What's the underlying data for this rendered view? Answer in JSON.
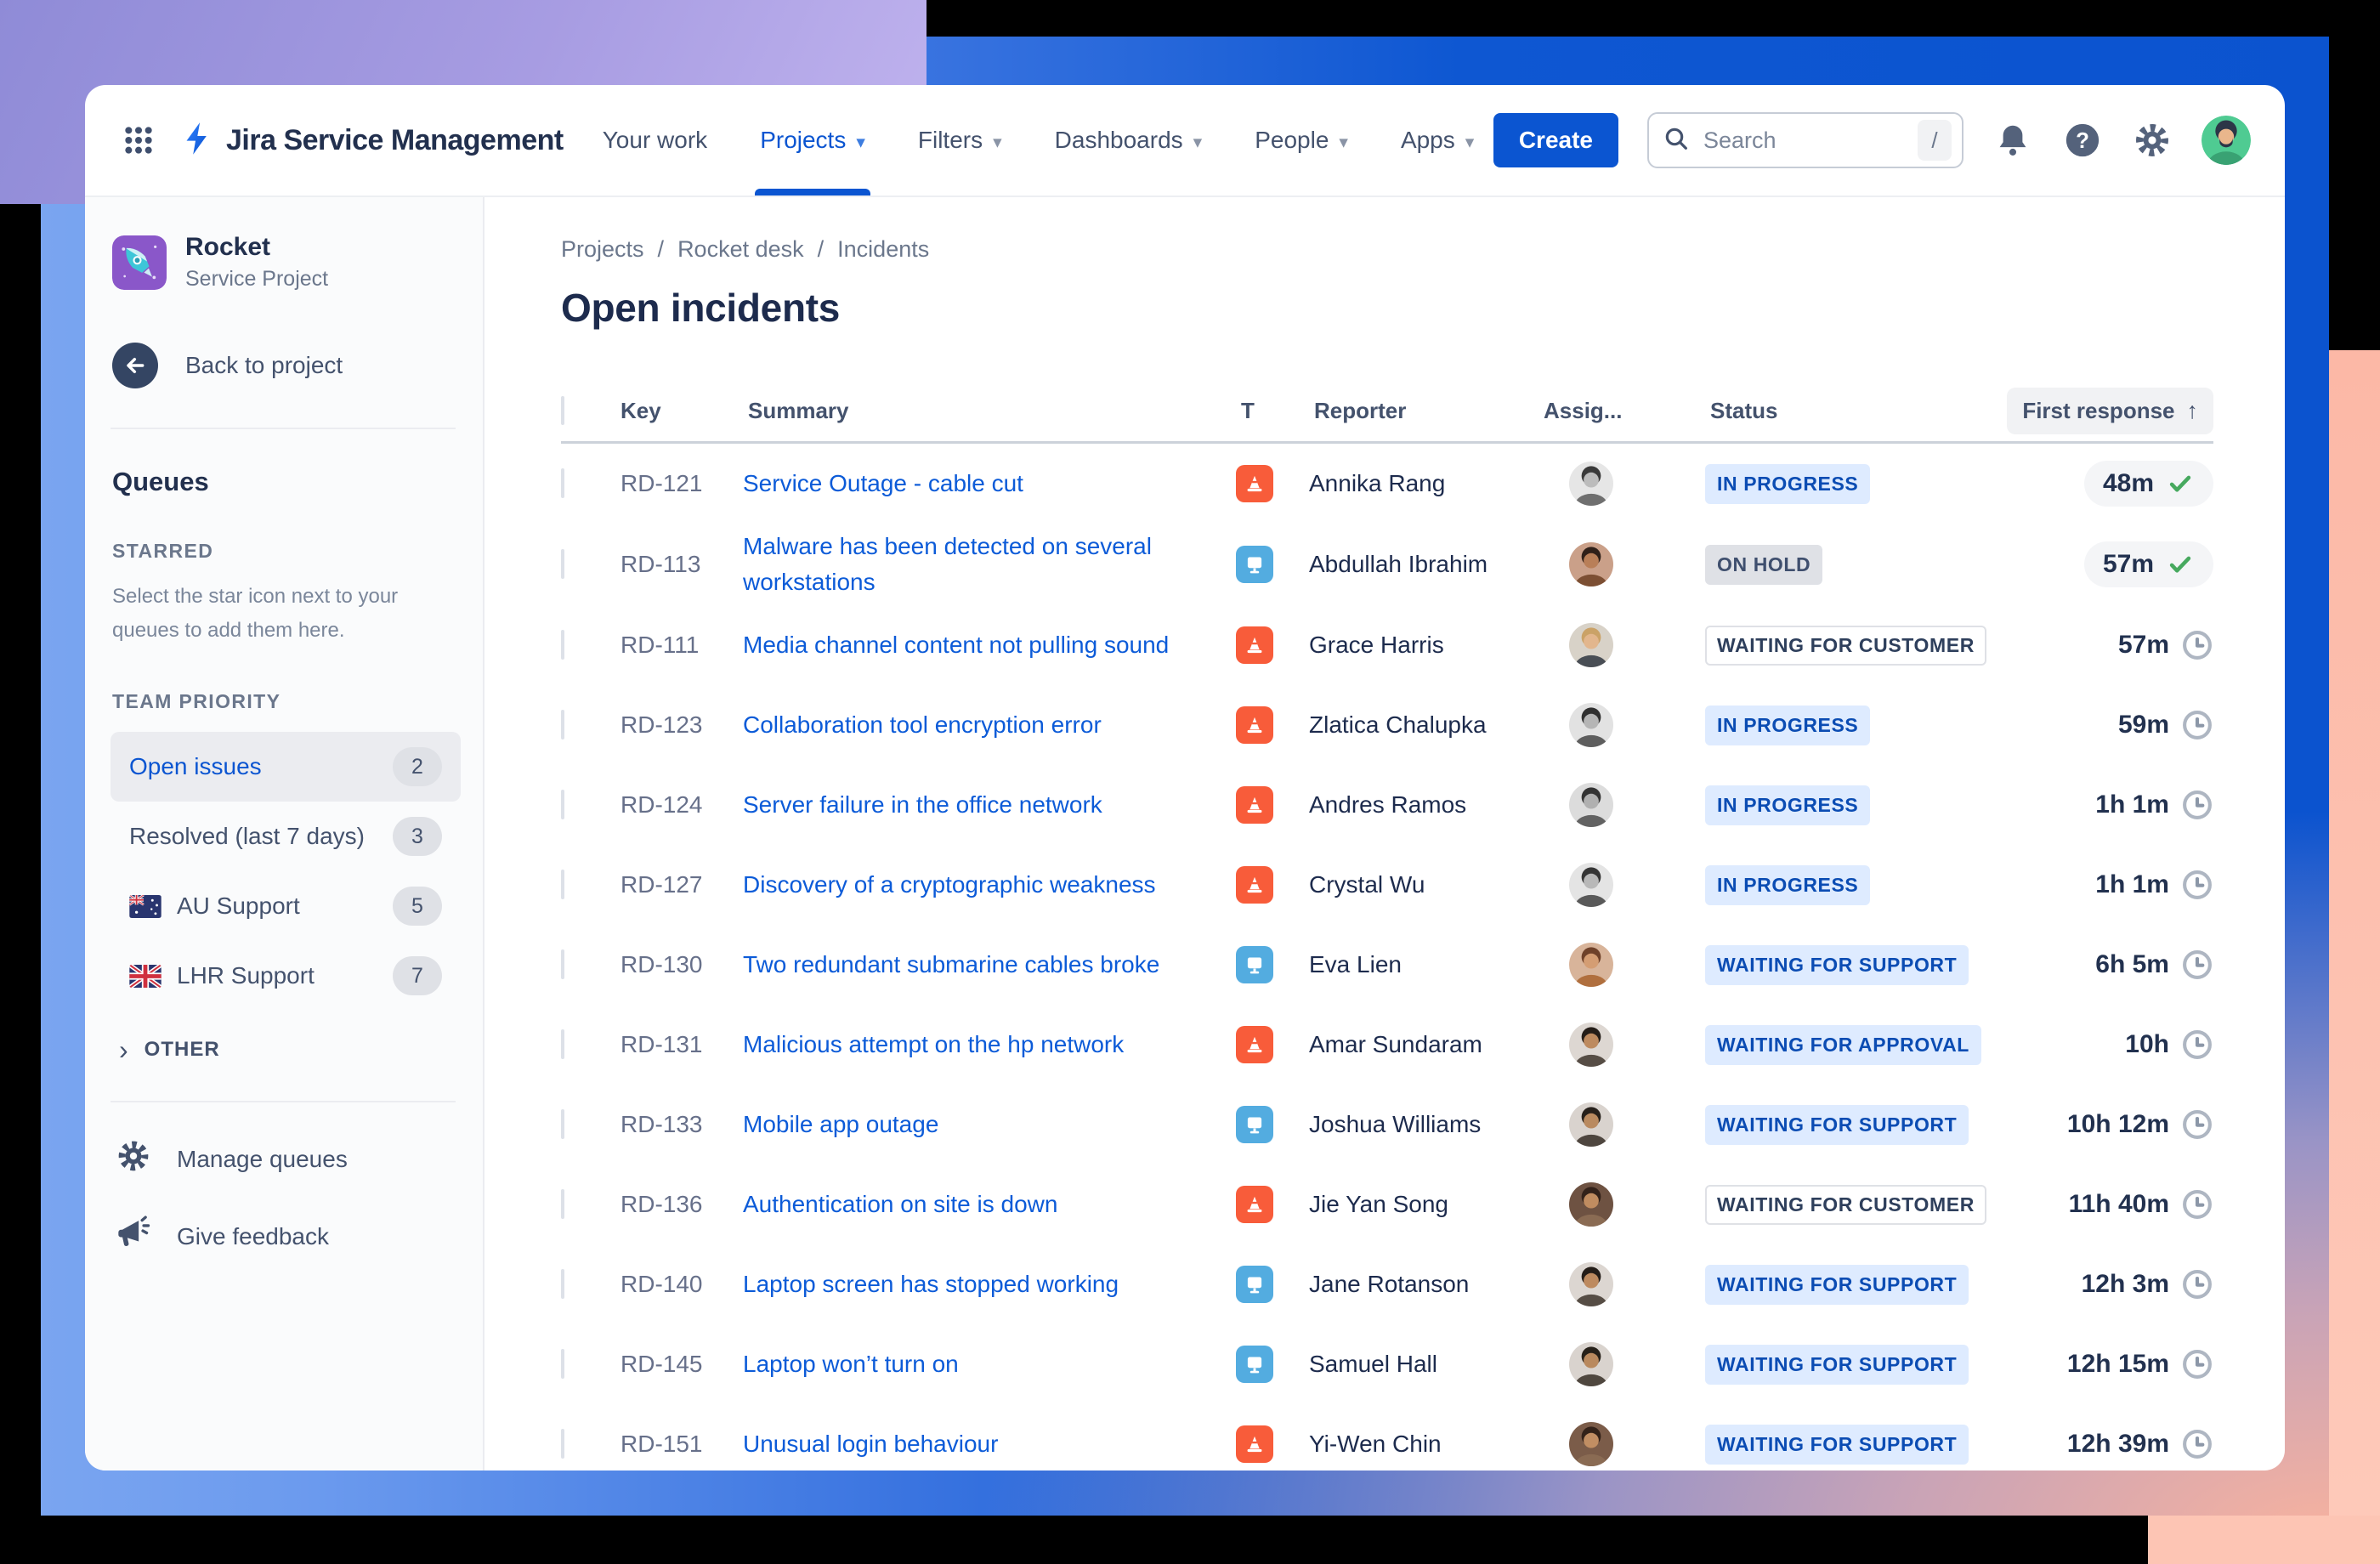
{
  "topbar": {
    "logo_text": "Jira Service Management",
    "nav": [
      {
        "label": "Your work",
        "caret": false,
        "active": false
      },
      {
        "label": "Projects",
        "caret": true,
        "active": true
      },
      {
        "label": "Filters",
        "caret": true,
        "active": false
      },
      {
        "label": "Dashboards",
        "caret": true,
        "active": false
      },
      {
        "label": "People",
        "caret": true,
        "active": false
      },
      {
        "label": "Apps",
        "caret": true,
        "active": false
      }
    ],
    "create_label": "Create",
    "search_placeholder": "Search",
    "search_shortcut": "/",
    "icons": [
      "app-switcher-icon",
      "bell-icon",
      "help-icon",
      "gear-icon",
      "user-avatar"
    ]
  },
  "sidebar": {
    "project_name": "Rocket",
    "project_type": "Service Project",
    "back_label": "Back to project",
    "queues_title": "Queues",
    "starred_label": "STARRED",
    "starred_hint": "Select the star icon next to your queues to add them here.",
    "team_priority_label": "TEAM PRIORITY",
    "queues": [
      {
        "label": "Open issues",
        "count": "2",
        "flag": null,
        "selected": true
      },
      {
        "label": "Resolved (last 7 days)",
        "count": "3",
        "flag": null,
        "selected": false
      },
      {
        "label": "AU Support",
        "count": "5",
        "flag": "au",
        "selected": false
      },
      {
        "label": "LHR Support",
        "count": "7",
        "flag": "gb",
        "selected": false
      }
    ],
    "other_label": "OTHER",
    "manage_label": "Manage queues",
    "feedback_label": "Give feedback"
  },
  "main": {
    "breadcrumb": [
      "Projects",
      "Rocket desk",
      "Incidents"
    ],
    "title": "Open incidents",
    "columns": {
      "key": "Key",
      "summary": "Summary",
      "type": "T",
      "reporter": "Reporter",
      "assignee": "Assig...",
      "status": "Status",
      "first_response": "First response",
      "sort_arrow": "↑"
    },
    "rows": [
      {
        "key": "RD-121",
        "summary": "Service Outage - cable cut",
        "type": "incident",
        "reporter": "Annika Rang",
        "status": {
          "label": "IN PROGRESS",
          "style": "blue"
        },
        "first_response": "48m",
        "met": true,
        "avatar": {
          "bg": "#e6e6e6",
          "skin": "#bcbcbc",
          "hair": "#3a3a3a",
          "shirt": "#6f6f6f"
        }
      },
      {
        "key": "RD-113",
        "summary": "Malware has been detected on several workstations",
        "type": "request",
        "reporter": "Abdullah Ibrahim",
        "status": {
          "label": "ON HOLD",
          "style": "gray"
        },
        "first_response": "57m",
        "met": true,
        "avatar": {
          "bg": "#caa089",
          "skin": "#b97f58",
          "hair": "#2f2019",
          "shirt": "#7c4f33"
        }
      },
      {
        "key": "RD-111",
        "summary": "Media channel content not pulling sound",
        "type": "incident",
        "reporter": "Grace Harris",
        "status": {
          "label": "WAITING FOR CUSTOMER",
          "style": "outline"
        },
        "first_response": "57m",
        "met": false,
        "avatar": {
          "bg": "#d8d2c8",
          "skin": "#e2b68d",
          "hair": "#caa267",
          "shirt": "#494e55"
        }
      },
      {
        "key": "RD-123",
        "summary": "Collaboration tool encryption error",
        "type": "incident",
        "reporter": "Zlatica Chalupka",
        "status": {
          "label": "IN PROGRESS",
          "style": "blue"
        },
        "first_response": "59m",
        "met": false,
        "avatar": {
          "bg": "#e2e2e2",
          "skin": "#b5b5b5",
          "hair": "#2f2f2f",
          "shirt": "#5e5e5e"
        }
      },
      {
        "key": "RD-124",
        "summary": "Server failure in the office network",
        "type": "incident",
        "reporter": "Andres Ramos",
        "status": {
          "label": "IN PROGRESS",
          "style": "blue"
        },
        "first_response": "1h 1m",
        "met": false,
        "avatar": {
          "bg": "#dcdcdc",
          "skin": "#b0b0b0",
          "hair": "#333333",
          "shirt": "#626262"
        }
      },
      {
        "key": "RD-127",
        "summary": "Discovery of a cryptographic weakness",
        "type": "incident",
        "reporter": "Crystal Wu",
        "status": {
          "label": "IN PROGRESS",
          "style": "blue"
        },
        "first_response": "1h 1m",
        "met": false,
        "avatar": {
          "bg": "#e4e4e4",
          "skin": "#b8b8b8",
          "hair": "#353535",
          "shirt": "#595959"
        }
      },
      {
        "key": "RD-130",
        "summary": "Two redundant submarine cables broke",
        "type": "request",
        "reporter": "Eva Lien",
        "status": {
          "label": "WAITING FOR SUPPORT",
          "style": "blue"
        },
        "first_response": "6h 5m",
        "met": false,
        "avatar": {
          "bg": "#d8b49a",
          "skin": "#d49d73",
          "hair": "#6e4129",
          "shirt": "#b06f3e"
        }
      },
      {
        "key": "RD-131",
        "summary": "Malicious attempt on the hp network",
        "type": "incident",
        "reporter": "Amar Sundaram",
        "status": {
          "label": "WAITING FOR APPROVAL",
          "style": "blue"
        },
        "first_response": "10h",
        "met": false,
        "avatar": {
          "bg": "#ddd7d2",
          "skin": "#bd8a5f",
          "hair": "#241d18",
          "shirt": "#564d45"
        }
      },
      {
        "key": "RD-133",
        "summary": "Mobile app outage",
        "type": "request",
        "reporter": "Joshua Williams",
        "status": {
          "label": "WAITING FOR SUPPORT",
          "style": "blue"
        },
        "first_response": "10h 12m",
        "met": false,
        "avatar": {
          "bg": "#d9d3ce",
          "skin": "#b98a60",
          "hair": "#26201b",
          "shirt": "#4e463f"
        }
      },
      {
        "key": "RD-136",
        "summary": "Authentication on site is down",
        "type": "incident",
        "reporter": "Jie Yan Song",
        "status": {
          "label": "WAITING FOR CUSTOMER",
          "style": "outline"
        },
        "first_response": "11h 40m",
        "met": false,
        "avatar": {
          "bg": "#6e5242",
          "skin": "#c08c60",
          "hair": "#33221a",
          "shirt": "#8a6b53"
        }
      },
      {
        "key": "RD-140",
        "summary": "Laptop screen has stopped working",
        "type": "request",
        "reporter": "Jane Rotanson",
        "status": {
          "label": "WAITING FOR SUPPORT",
          "style": "blue"
        },
        "first_response": "12h 3m",
        "met": false,
        "avatar": {
          "bg": "#dcd6d1",
          "skin": "#bd8a5f",
          "hair": "#241d18",
          "shirt": "#564d45"
        }
      },
      {
        "key": "RD-145",
        "summary": "Laptop won’t turn on",
        "type": "request",
        "reporter": "Samuel Hall",
        "status": {
          "label": "WAITING FOR SUPPORT",
          "style": "blue"
        },
        "first_response": "12h 15m",
        "met": false,
        "avatar": {
          "bg": "#d9d3ce",
          "skin": "#b9895e",
          "hair": "#262019",
          "shirt": "#4f473f"
        }
      },
      {
        "key": "RD-151",
        "summary": "Unusual login behaviour",
        "type": "incident",
        "reporter": "Yi-Wen Chin",
        "status": {
          "label": "WAITING FOR SUPPORT",
          "style": "blue"
        },
        "first_response": "12h 39m",
        "met": false,
        "avatar": {
          "bg": "#7b5c49",
          "skin": "#c18e63",
          "hair": "#332219",
          "shirt": "#8a6b53"
        }
      }
    ]
  },
  "colors": {
    "accent_blue": "#0B55D1",
    "link_blue": "#0C5BD8",
    "status_blue_bg": "#DEEBFF",
    "status_blue_text": "#0B4CB3",
    "status_gray_bg": "#DFE1E6",
    "incident_icon": "#F85C3A",
    "request_icon": "#53ACE0",
    "met_green": "#47A95F",
    "bg_purple": "#A79CE2",
    "bg_salmon": "#FDC2B0",
    "frame_blue": "#0B53CF"
  }
}
